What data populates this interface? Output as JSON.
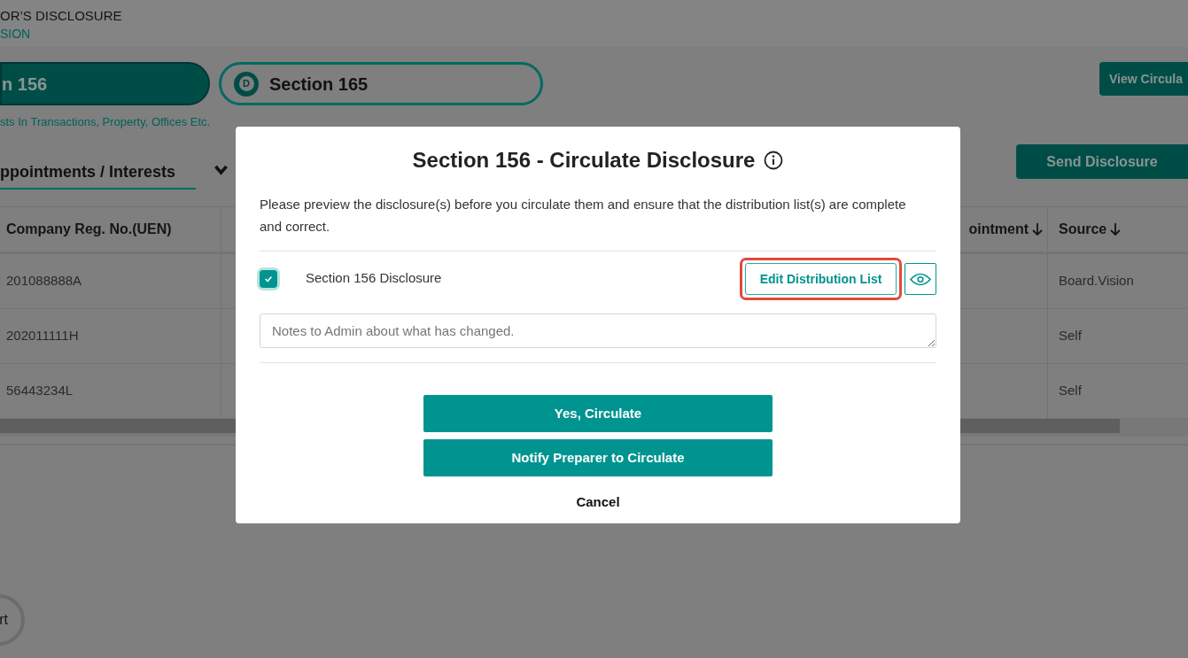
{
  "header": {
    "title": "OR’S DISCLOSURE",
    "subtitle": "SION"
  },
  "section_tabs": [
    {
      "label": "n 156",
      "selected": true
    },
    {
      "label": "Section 165",
      "badge": "D",
      "selected": false
    }
  ],
  "section_description": "sts In Transactions, Property, Offices Etc.",
  "view_button": "View Circula",
  "sub_tab": {
    "label": "ppointments / Interests",
    "selected": true
  },
  "send_button": "Send Disclosure",
  "table": {
    "columns": [
      {
        "label": "Company Reg. No.(UEN)",
        "sortable": false
      },
      {
        "label": "ointment",
        "sortable": true
      },
      {
        "label": "Source",
        "sortable": true
      }
    ],
    "rows": [
      {
        "uen": "201088888A",
        "source": "Board.Vision"
      },
      {
        "uen": "202011111H",
        "source": "Self"
      },
      {
        "uen": "56443234L",
        "source": "Self"
      }
    ]
  },
  "floating_button": "rt",
  "modal": {
    "title": "Section 156 - Circulate Disclosure",
    "message": "Please preview the disclosure(s) before you circulate them and ensure that the distribution list(s) are complete and correct.",
    "items": [
      {
        "label": "Section 156 Disclosure",
        "checked": true,
        "edit_button": "Edit Distribution List",
        "highlighted": true
      }
    ],
    "notes_placeholder": "Notes to Admin about what has changed.",
    "buttons": [
      "Yes, Circulate",
      "Notify Preparer to Circulate"
    ],
    "cancel": "Cancel"
  }
}
